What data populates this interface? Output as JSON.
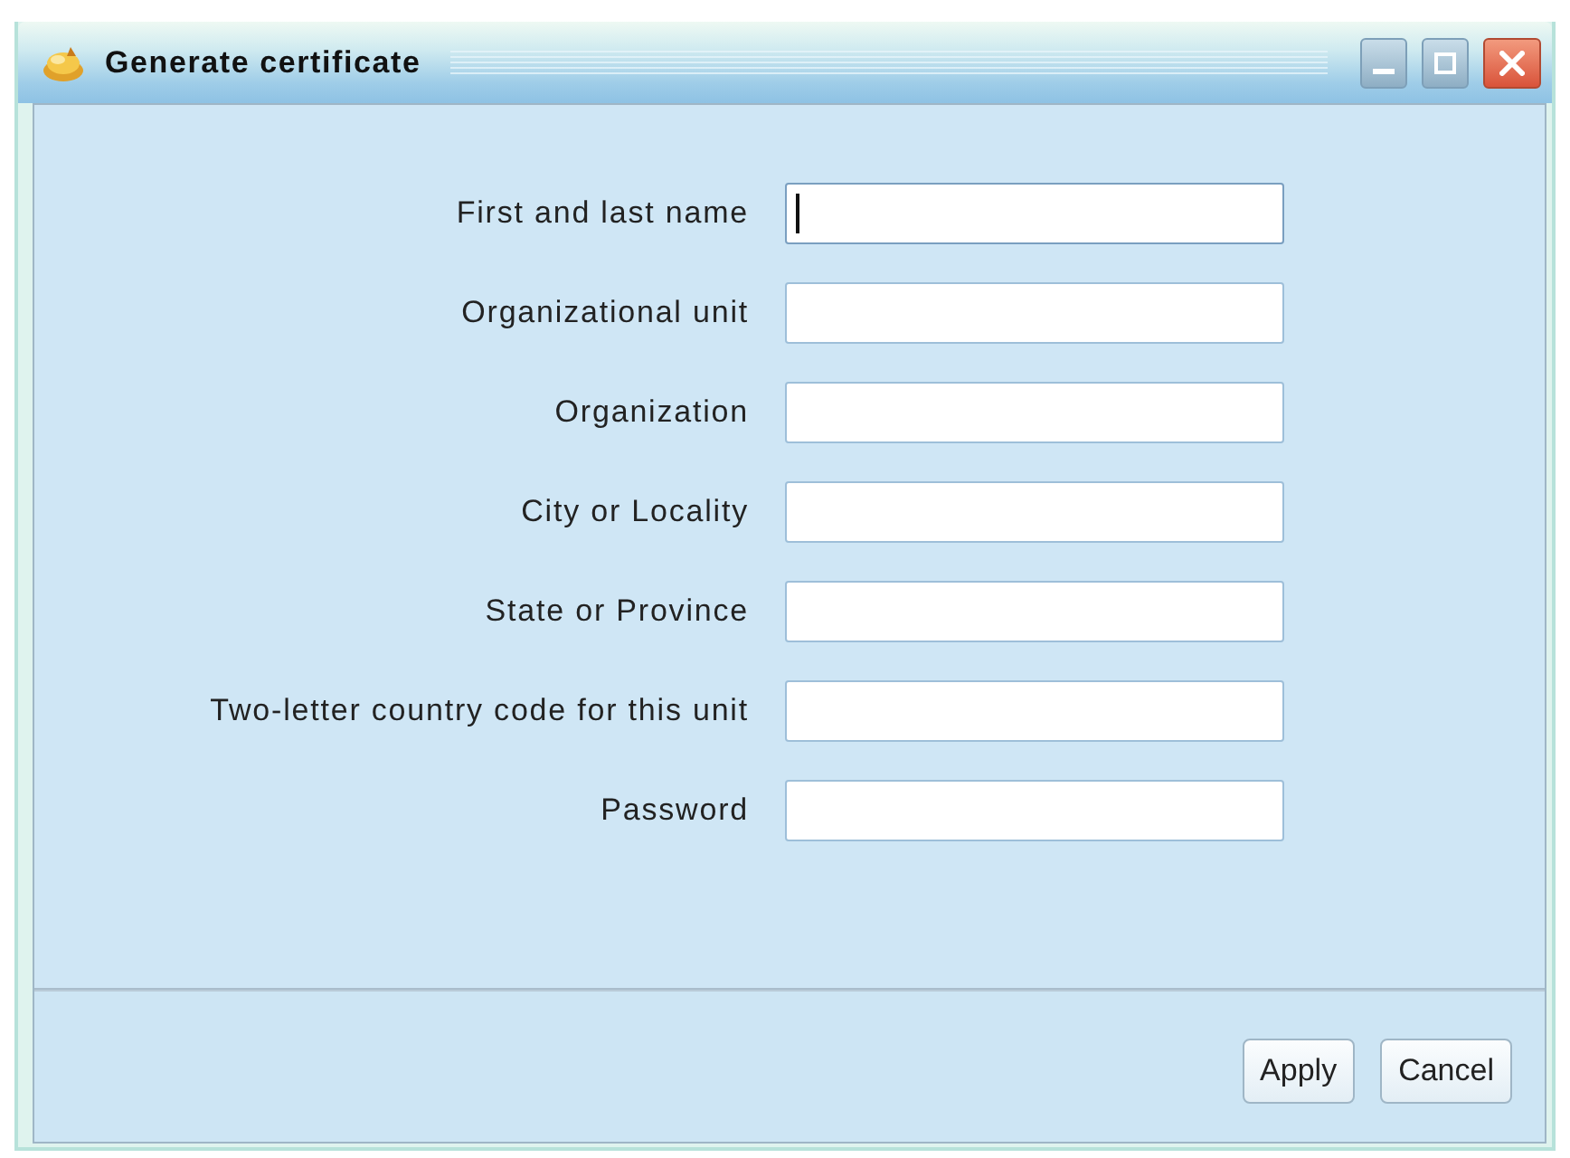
{
  "window": {
    "title": "Generate certificate",
    "controls": [
      {
        "kind": "minimize"
      },
      {
        "kind": "maximize"
      },
      {
        "kind": "close"
      }
    ]
  },
  "form": {
    "fields": [
      {
        "label": "First and last name",
        "focused": true
      },
      {
        "label": "Organizational unit",
        "focused": false
      },
      {
        "label": "Organization",
        "focused": false
      },
      {
        "label": "City or Locality",
        "focused": false
      },
      {
        "label": "State or Province",
        "focused": false
      },
      {
        "label": "Two-letter country code for this unit",
        "focused": false
      },
      {
        "label": "Password",
        "focused": false
      }
    ]
  },
  "buttons": [
    {
      "label": "Apply"
    },
    {
      "label": "Cancel"
    }
  ]
}
